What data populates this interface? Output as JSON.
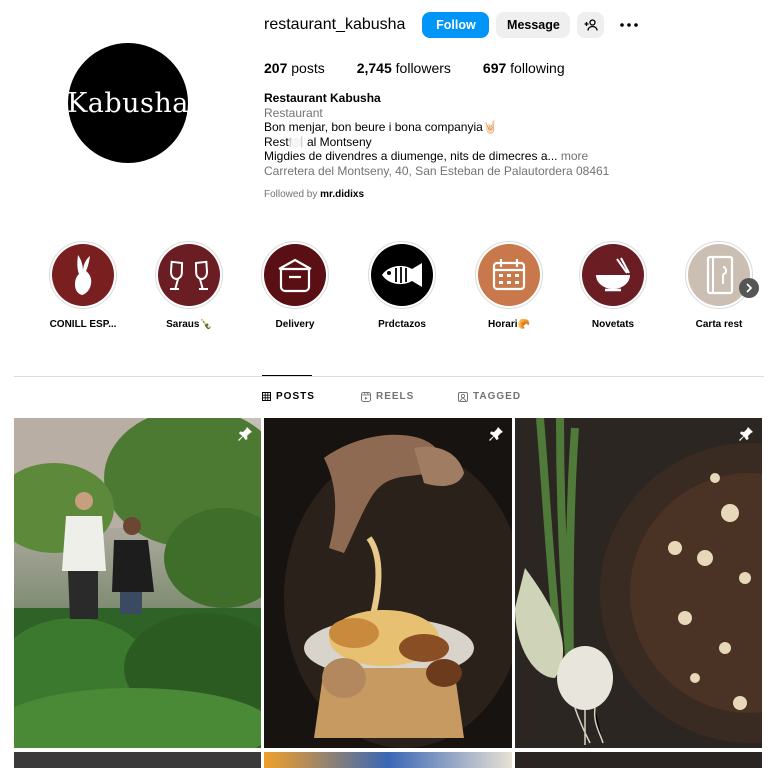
{
  "profile": {
    "username": "restaurant_kabusha",
    "avatar_text": "Kabusha",
    "follow_label": "Follow",
    "message_label": "Message",
    "stats": {
      "posts_count": "207",
      "posts_label": "posts",
      "followers_count": "2,745",
      "followers_label": "followers",
      "following_count": "697",
      "following_label": "following"
    },
    "bio": {
      "name": "Restaurant Kabusha",
      "category": "Restaurant",
      "line1": "Bon menjar, bon beure i bona companyia🤘🏻",
      "line2": "Rest🍽️ al Montseny",
      "line3": "Migdies de divendres a diumenge, nits de dimecres a...",
      "more": "more",
      "address": "Carretera del Montseny, 40, San Esteban de Palautordera 08461"
    },
    "followed_by_prefix": "Followed by",
    "followed_by_user": "mr.didixs"
  },
  "highlights": [
    {
      "label": "CONILL ESP...",
      "icon": "rabbit-icon",
      "color": "#7a1f1f"
    },
    {
      "label": "Saraus🍾",
      "icon": "wine-glasses-icon",
      "color": "#6b1d24"
    },
    {
      "label": "Delivery",
      "icon": "takeaway-box-icon",
      "color": "#5a0f14"
    },
    {
      "label": "Prdctazos",
      "icon": "fish-icon",
      "color": "#000000"
    },
    {
      "label": "Horari🥐",
      "icon": "calendar-icon",
      "color": "#c8784a"
    },
    {
      "label": "Novetats",
      "icon": "bowl-icon",
      "color": "#6b1d24"
    },
    {
      "label": "Carta rest",
      "icon": "menu-book-icon",
      "color": "#cbbfb4"
    }
  ],
  "tabs": [
    {
      "label": "POSTS",
      "icon": "grid-icon",
      "active": true
    },
    {
      "label": "REELS",
      "icon": "reels-icon",
      "active": false
    },
    {
      "label": "TAGGED",
      "icon": "tagged-icon",
      "active": false
    }
  ],
  "colors": {
    "accent": "#0095f6",
    "secondary_button": "#efefef",
    "muted_text": "#737373"
  }
}
